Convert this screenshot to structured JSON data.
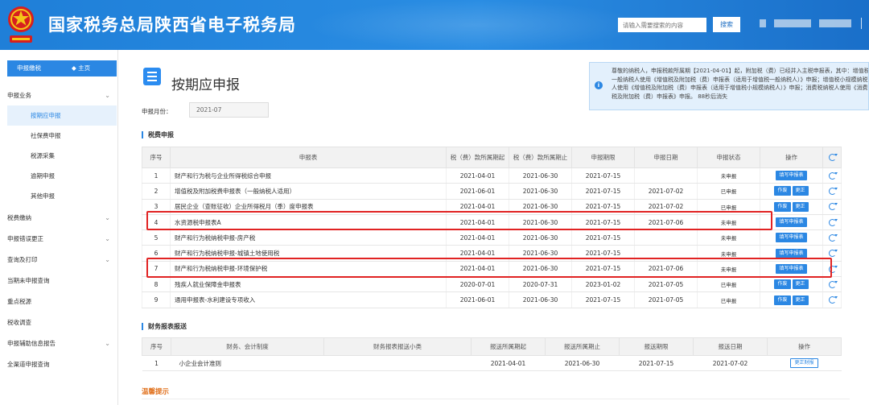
{
  "header": {
    "site_title": "国家税务总局陕西省电子税务局",
    "search_placeholder": "请输入需要搜索的内容",
    "search_button": "搜索",
    "colors": {
      "primary": "#2b87e3",
      "highlight": "#e12323"
    }
  },
  "sidebar": {
    "head_left": "申报缴税",
    "head_right": "◆ 主页",
    "items": [
      {
        "label": "申报业务",
        "type": "section",
        "chevron": true
      },
      {
        "label": "按期应申报",
        "type": "sub",
        "active": true
      },
      {
        "label": "社保费申报",
        "type": "sub"
      },
      {
        "label": "税源采集",
        "type": "sub"
      },
      {
        "label": "逾期申报",
        "type": "sub"
      },
      {
        "label": "其他申报",
        "type": "sub"
      },
      {
        "label": "税费缴纳",
        "type": "section",
        "chevron": true
      },
      {
        "label": "申报错误更正",
        "type": "section",
        "chevron": true
      },
      {
        "label": "查询及打印",
        "type": "section",
        "chevron": true
      },
      {
        "label": "当期未申报查询",
        "type": "section"
      },
      {
        "label": "重点税源",
        "type": "section"
      },
      {
        "label": "税收调查",
        "type": "section"
      },
      {
        "label": "申报辅助信息报告",
        "type": "section",
        "chevron": true
      },
      {
        "label": "全渠道申报查询",
        "type": "section"
      }
    ]
  },
  "main": {
    "page_title": "按期应申报",
    "notice_icon": "info-icon",
    "notice": "尊敬的纳税人，申报税款所属期【2021-04-01】起，附加税（费）已经并入主税申报表，其中：增值税一般纳税人使用《增值税及附加税（费）申报表（适用于增值税一般纳税人）》申报；增值税小规模纳税人使用《增值税及附加税（费）申报表（适用于增值税小规模纳税人）》申报；消费税纳税人使用《消费税及附加税（费）申报表》申报。 88秒后消失",
    "period_label": "申报月份：",
    "period_value": "2021-07",
    "tax_section_title": "税费申报",
    "tax_headers": [
      "序号",
      "申报表",
      "税（费）款所属期起",
      "税（费）款所属期止",
      "申报期限",
      "申报日期",
      "申报状态",
      "操作"
    ],
    "tax_rows": [
      {
        "no": "1",
        "name": "财产和行为税与企业所得税综合申报",
        "start": "2021-04-01",
        "end": "2021-06-30",
        "deadline": "2021-07-15",
        "date": "",
        "status": "未申报",
        "actions": [
          "填写申报表"
        ]
      },
      {
        "no": "2",
        "name": "增值税及附加税费申报表（一般纳税人适用）",
        "start": "2021-06-01",
        "end": "2021-06-30",
        "deadline": "2021-07-15",
        "date": "2021-07-02",
        "status": "已申报",
        "actions": [
          "作废",
          "更正"
        ]
      },
      {
        "no": "3",
        "name": "居民企业（查账征收）企业所得税月（季）度申报表",
        "start": "2021-04-01",
        "end": "2021-06-30",
        "deadline": "2021-07-15",
        "date": "2021-07-02",
        "status": "已申报",
        "actions": [
          "作废",
          "更正"
        ]
      },
      {
        "no": "4",
        "name": "水资源税申报表A",
        "start": "2021-04-01",
        "end": "2021-06-30",
        "deadline": "2021-07-15",
        "date": "2021-07-06",
        "status": "未申报",
        "actions": [
          "填写申报表"
        ]
      },
      {
        "no": "5",
        "name": "财产和行为税纳税申报-房产税",
        "start": "2021-04-01",
        "end": "2021-06-30",
        "deadline": "2021-07-15",
        "date": "",
        "status": "未申报",
        "actions": [
          "填写申报表"
        ]
      },
      {
        "no": "6",
        "name": "财产和行为税纳税申报-城镇土地使用税",
        "start": "2021-04-01",
        "end": "2021-06-30",
        "deadline": "2021-07-15",
        "date": "",
        "status": "未申报",
        "actions": [
          "填写申报表"
        ]
      },
      {
        "no": "7",
        "name": "财产和行为税纳税申报-环境保护税",
        "start": "2021-04-01",
        "end": "2021-06-30",
        "deadline": "2021-07-15",
        "date": "2021-07-06",
        "status": "未申报",
        "actions": [
          "填写申报表"
        ]
      },
      {
        "no": "8",
        "name": "残疾人就业保障金申报表",
        "start": "2020-07-01",
        "end": "2020-07-31",
        "deadline": "2023-01-02",
        "date": "2021-07-05",
        "status": "已申报",
        "actions": [
          "作废",
          "更正"
        ]
      },
      {
        "no": "9",
        "name": "通用申报表-水利建设专项收入",
        "start": "2021-06-01",
        "end": "2021-06-30",
        "deadline": "2021-07-15",
        "date": "2021-07-05",
        "status": "已申报",
        "actions": [
          "作废",
          "更正"
        ]
      }
    ],
    "fin_section_title": "财务报表报送",
    "fin_headers": [
      "序号",
      "财务、会计制度",
      "财务报表报送小类",
      "报送所属期起",
      "报送所属期止",
      "报送期限",
      "报送日期",
      "操作"
    ],
    "fin_rows": [
      {
        "no": "1",
        "system": "小企业会计准则",
        "category": "",
        "start": "2021-04-01",
        "end": "2021-06-30",
        "deadline": "2021-07-15",
        "date": "2021-07-02",
        "action": "更正财报"
      }
    ],
    "tips_title": "温馨提示"
  }
}
